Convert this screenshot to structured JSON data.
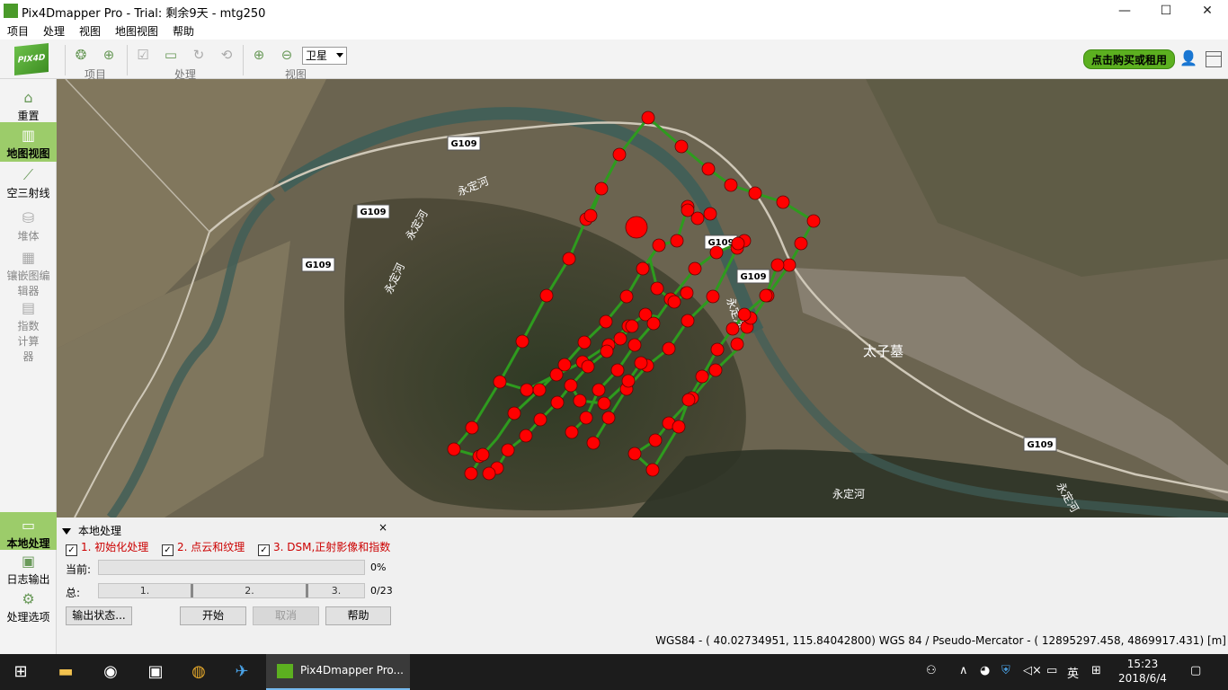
{
  "window": {
    "title": "Pix4Dmapper Pro - Trial: 剩余9天 - mtg250",
    "controls": {
      "minimize": "—",
      "maximize": "☐",
      "close": "✕"
    }
  },
  "menu": [
    "项目",
    "处理",
    "视图",
    "地图视图",
    "帮助"
  ],
  "toolbar": {
    "logo_text": "PIX4D",
    "groups": {
      "project": "项目",
      "process": "处理",
      "view": "视图"
    },
    "basemap_select": "卫星",
    "buy_button": "点击购买或租用"
  },
  "sidebar": [
    {
      "label": "重置",
      "icon": "home-icon"
    },
    {
      "label": "地图视图",
      "icon": "map-icon",
      "active": true
    },
    {
      "label": "空三射线",
      "icon": "rays-icon"
    },
    {
      "label": "堆体",
      "icon": "volume-icon"
    },
    {
      "label": "镶嵌图编辑器",
      "icon": "mosaic-icon"
    },
    {
      "label": "指数计算器",
      "icon": "index-calculator-icon"
    },
    {
      "label": "本地处理",
      "icon": "local-processing-icon",
      "active": true
    },
    {
      "label": "日志输出",
      "icon": "log-icon"
    },
    {
      "label": "处理选项",
      "icon": "gear-icon"
    }
  ],
  "map": {
    "road_labels": [
      "G109",
      "G109",
      "G109",
      "G109",
      "G109",
      "G109"
    ],
    "river_labels": [
      "永定河",
      "永定河",
      "永定河",
      "永定河",
      "永定河",
      "永定河"
    ],
    "place_label": "太子墓",
    "colors": {
      "flight_line": "#2e9b1e",
      "image_point": "#ff0000"
    }
  },
  "processing": {
    "title": "本地处理",
    "close": "×",
    "steps": [
      {
        "label": "1. 初始化处理",
        "checked": true
      },
      {
        "label": "2. 点云和纹理",
        "checked": true
      },
      {
        "label": "3. DSM,正射影像和指数",
        "checked": true
      }
    ],
    "current_label": "当前:",
    "current_percent": "0%",
    "current_progress": 0,
    "total_label": "总:",
    "total_segments": [
      "1.",
      "2.",
      "3."
    ],
    "total_count": "0/23",
    "buttons": {
      "output_status": "输出状态...",
      "start": "开始",
      "cancel": "取消",
      "help": "帮助"
    }
  },
  "statusbar": {
    "coords": "WGS84 - ( 40.02734951,  115.84042800)  WGS 84 / Pseudo-Mercator - ( 12895297.458,   4869917.431) [m]"
  },
  "taskbar": {
    "active_app": "Pix4Dmapper Pro...",
    "ime": "英",
    "time": "15:23",
    "date": "2018/6/4"
  }
}
